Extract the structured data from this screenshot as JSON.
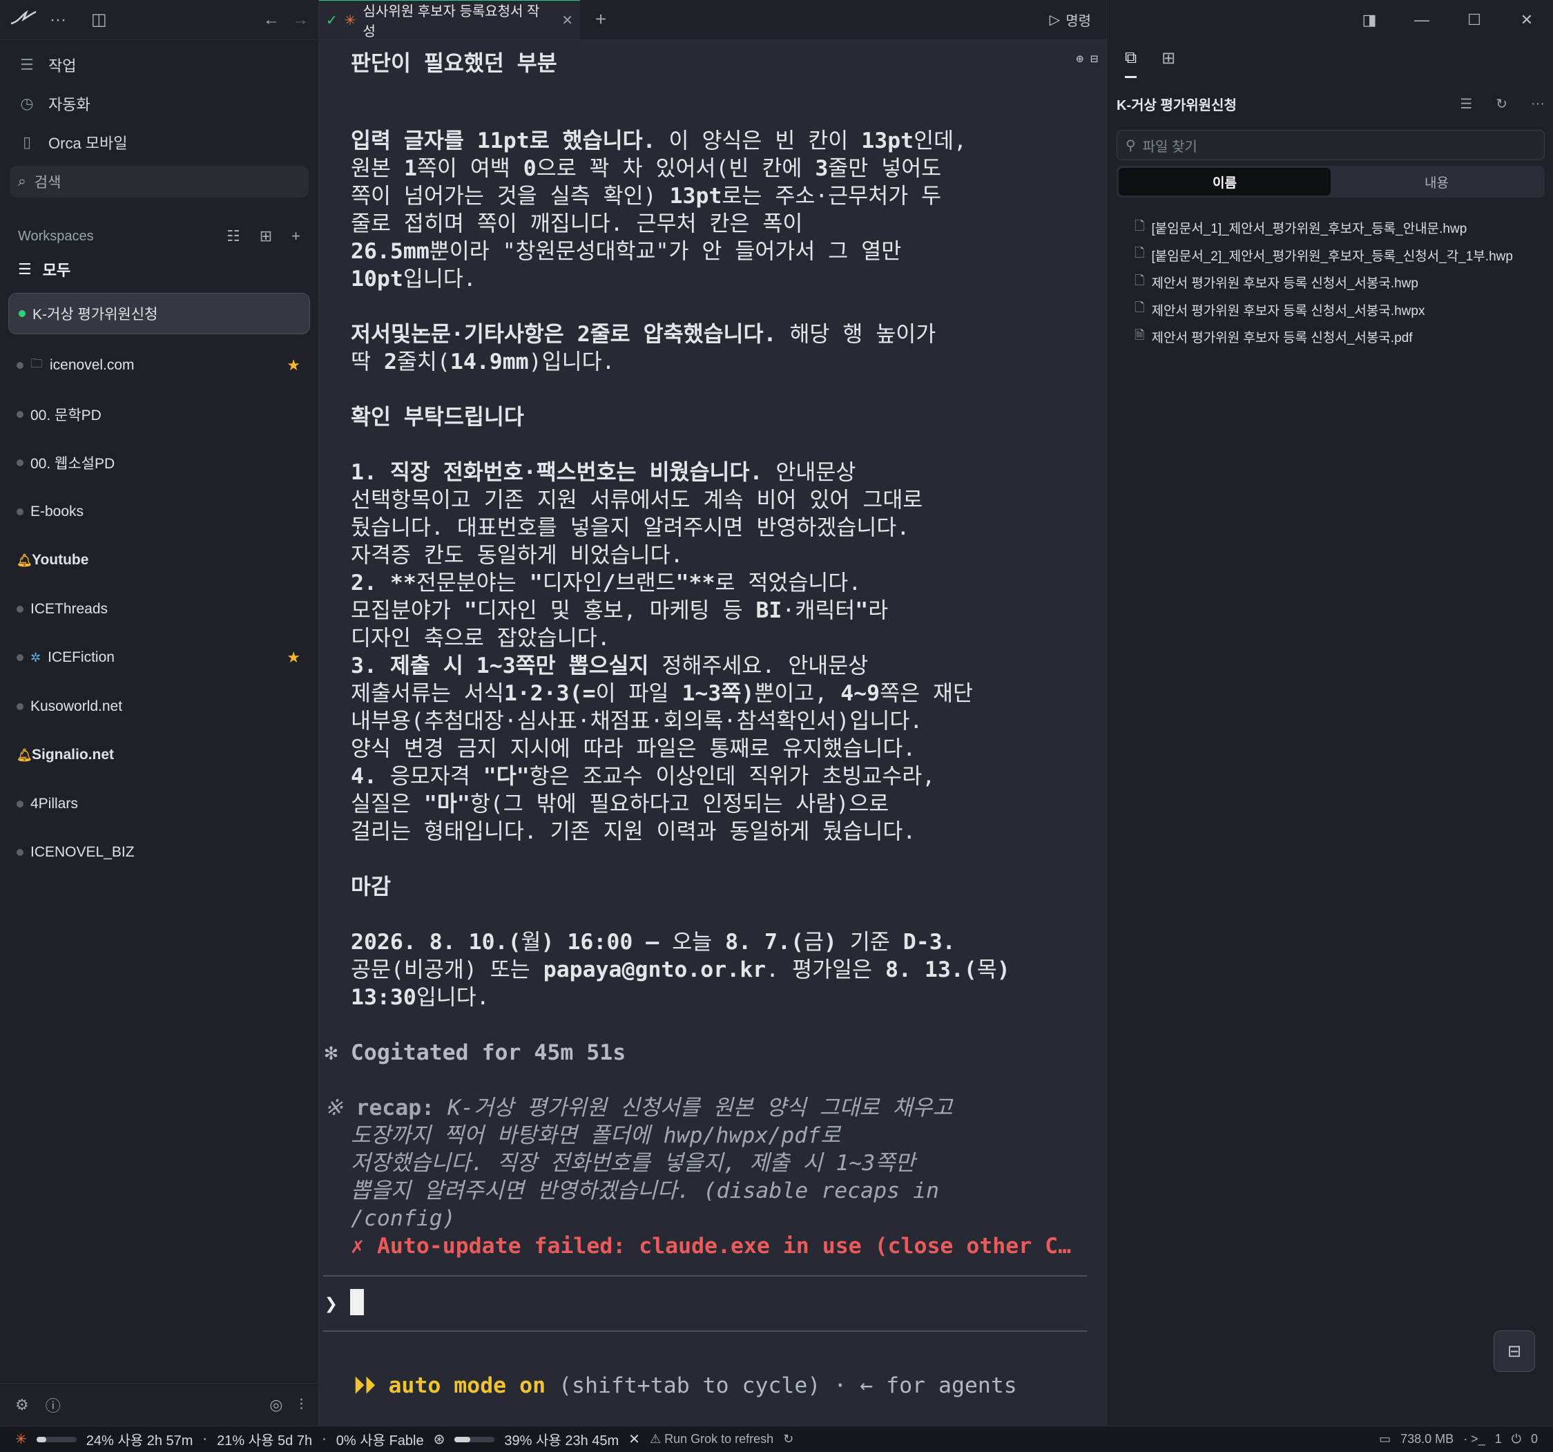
{
  "sidebar": {
    "nav": [
      {
        "label": "작업",
        "icon": "list-icon"
      },
      {
        "label": "자동화",
        "icon": "calendar-clock-icon"
      },
      {
        "label": "Orca 모바일",
        "icon": "phone-icon"
      }
    ],
    "search_label": "검색",
    "workspaces_label": "Workspaces",
    "all_label": "모두",
    "items": [
      {
        "label": "K-거상 평가위원신청",
        "active": true
      },
      {
        "label": "icenovel.com",
        "folder": true,
        "starred": true
      },
      {
        "label": "00. 문학PD"
      },
      {
        "label": "00. 웹소설PD"
      },
      {
        "label": "E-books"
      },
      {
        "label": "Youtube",
        "bell": true,
        "bold": true
      },
      {
        "label": "ICEThreads"
      },
      {
        "label": "ICEFiction",
        "dragon": true,
        "starred": true
      },
      {
        "label": "Kusoworld.net"
      },
      {
        "label": "Signalio.net",
        "bell": true,
        "bold": true
      },
      {
        "label": "4Pillars"
      },
      {
        "label": "ICENOVEL_BIZ"
      }
    ]
  },
  "tab": {
    "title": "심사위원 후보자 등록요청서 작성",
    "command_label": "명령"
  },
  "terminal": {
    "line01": "판단이 필요했던 부분",
    "line02a": "입력 글자를 ",
    "line02b": "11pt",
    "line02c": "로 했습니다.",
    "line02d": " 이 양식은 빈 칸이 ",
    "line02e": "13pt",
    "line02f": "인데,",
    "line03a": "원본 ",
    "line03b": "1",
    "line03c": "쪽이 여백 ",
    "line03d": "0",
    "line03e": "으로 꽉 차 있어서(빈 칸에 ",
    "line03f": "3",
    "line03g": "줄만 넣어도",
    "line04a": "쪽이 넘어가는 것을 실측 확인) ",
    "line04b": "13pt",
    "line04c": "로는 주소·근무처가 두",
    "line05": "줄로 접히며 쪽이 깨집니다. 근무처 칸은 폭이",
    "line06a": "26.5mm",
    "line06b": "뿐이라 \"창원문성대학교\"가 안 들어가서 그 열만",
    "line07a": "10pt",
    "line07b": "입니다.",
    "line08a": "저서및논문·기타사항은 ",
    "line08b": "2",
    "line08c": "줄로 압축했습니다.",
    "line08d": " 해당 행 높이가",
    "line09a": "딱 ",
    "line09b": "2",
    "line09c": "줄치(",
    "line09d": "14.9mm",
    "line09e": ")입니다.",
    "line10": "확인 부탁드립니다",
    "line11a": "1. 직장 전화번호·팩스번호는 비웠습니다.",
    "line11b": " 안내문상",
    "line12": "선택항목이고 기존 지원 서류에서도 계속 비어 있어 그대로",
    "line13": "뒀습니다. 대표번호를 넣을지 알려주시면 반영하겠습니다.",
    "line14": "자격증 칸도 동일하게 비었습니다.",
    "line15a": "2. ",
    "line15b": "**",
    "line15c": "전문분야는 ",
    "line15d": "\"",
    "line15e": "디자인",
    "line15f": "/",
    "line15g": "브랜드",
    "line15h": "\"**",
    "line15i": "로 적었습니다.",
    "line16a": "모집분야가 ",
    "line16b": "\"",
    "line16c": "디자인 및 홍보, 마케팅 등 ",
    "line16d": "BI",
    "line16e": "·캐릭터",
    "line16f": "\"",
    "line16g": "라",
    "line17": "디자인 축으로 잡았습니다.",
    "line18a": "3. 제출 시 ",
    "line18b": "1~3",
    "line18c": "쪽만 뽑으실지",
    "line18d": " 정해주세요. 안내문상",
    "line19a": "제출서류는 서식",
    "line19b": "1·2·3(=",
    "line19c": "이 파일 ",
    "line19d": "1~3",
    "line19e": "쪽)",
    "line19f": "뿐이고, ",
    "line19g": "4~9",
    "line19h": "쪽은 재단",
    "line20": "내부용(추첨대장·심사표·채점표·회의록·참석확인서)입니다.",
    "line21": "양식 변경 금지 지시에 따라 파일은 통째로 유지했습니다.",
    "line22a": "4. ",
    "line22b": "응모자격 ",
    "line22c": "\"다\"",
    "line22d": "항은 조교수 이상인데 직위가 초빙교수라,",
    "line23a": "실질은 ",
    "line23b": "\"마\"",
    "line23c": "항(그 밖에 필요하다고 인정되는 사람)으로",
    "line24": "걸리는 형태입니다. 기존 지원 이력과 동일하게 뒀습니다.",
    "line25": "마감",
    "line26a": "2026. 8. 10.(",
    "line26b": "월",
    "line26c": ") 16:00 — ",
    "line26d": "오늘 ",
    "line26e": "8. 7.(",
    "line26f": "금",
    "line26g": ") ",
    "line26h": "기준 ",
    "line26i": "D-3.",
    "line27a": "공문(비공개) 또는 ",
    "line27b": "papaya@gnto.or.kr",
    "line27c": ". 평가일은 ",
    "line27d": "8. 13.(",
    "line27e": "목",
    "line27f": ")",
    "line28a": "13:30",
    "line28b": "입니다.",
    "cogitated": "✻ Cogitated for 45m 51s",
    "recap1a": "※ ",
    "recap1b": "recap:",
    "recap1c": " K-거상 평가위원 신청서를 원본 양식 그대로 채우고",
    "recap2": "도장까지 찍어 바탕화면 폴더에 hwp/hwpx/pdf로",
    "recap3": "저장했습니다. 직장 전화번호를 넣을지, 제출 시 1~3쪽만",
    "recap4": "뽑을지 알려주시면 반영하겠습니다. (disable recaps in",
    "recap5": "/config)",
    "error": "✗ Auto-update failed: claude.exe in use (close other C…",
    "prompt_symbol": "❯",
    "auto_mode_a": "⏵⏵ auto mode on",
    "auto_mode_b": " (shift+tab to cycle) · ← for agents"
  },
  "right_panel": {
    "title": "K-거상 평가위원신청",
    "search_placeholder": "파일 찾기",
    "seg_name": "이름",
    "seg_content": "내용",
    "files": [
      "[붙임문서_1]_제안서_평가위원_후보자_등록_안내문.hwp",
      "[붙임문서_2]_제안서_평가위원_후보자_등록_신청서_각_1부.hwp",
      "제안서 평가위원 후보자 등록 신청서_서봉국.hwp",
      "제안서 평가위원 후보자 등록 신청서_서봉국.hwpx",
      "제안서 평가위원 후보자 등록 신청서_서봉국.pdf"
    ]
  },
  "status": {
    "claude_usage": "24% 사용 2h 57m",
    "claude_fill": 0.24,
    "weekly": "21% 사용 5d 7h",
    "fable": "0% 사용 Fable",
    "openai_fill": 0.39,
    "openai_usage": "39% 사용 23h 45m",
    "grok": "⚠ Run Grok to refresh",
    "memory": "738.0 MB",
    "terminals": "1",
    "ports": "0"
  },
  "colors": {
    "accent_green": "#2fd07a",
    "star": "#f5b830",
    "error": "#ec5b5b",
    "auto_mode": "#f1c232"
  }
}
